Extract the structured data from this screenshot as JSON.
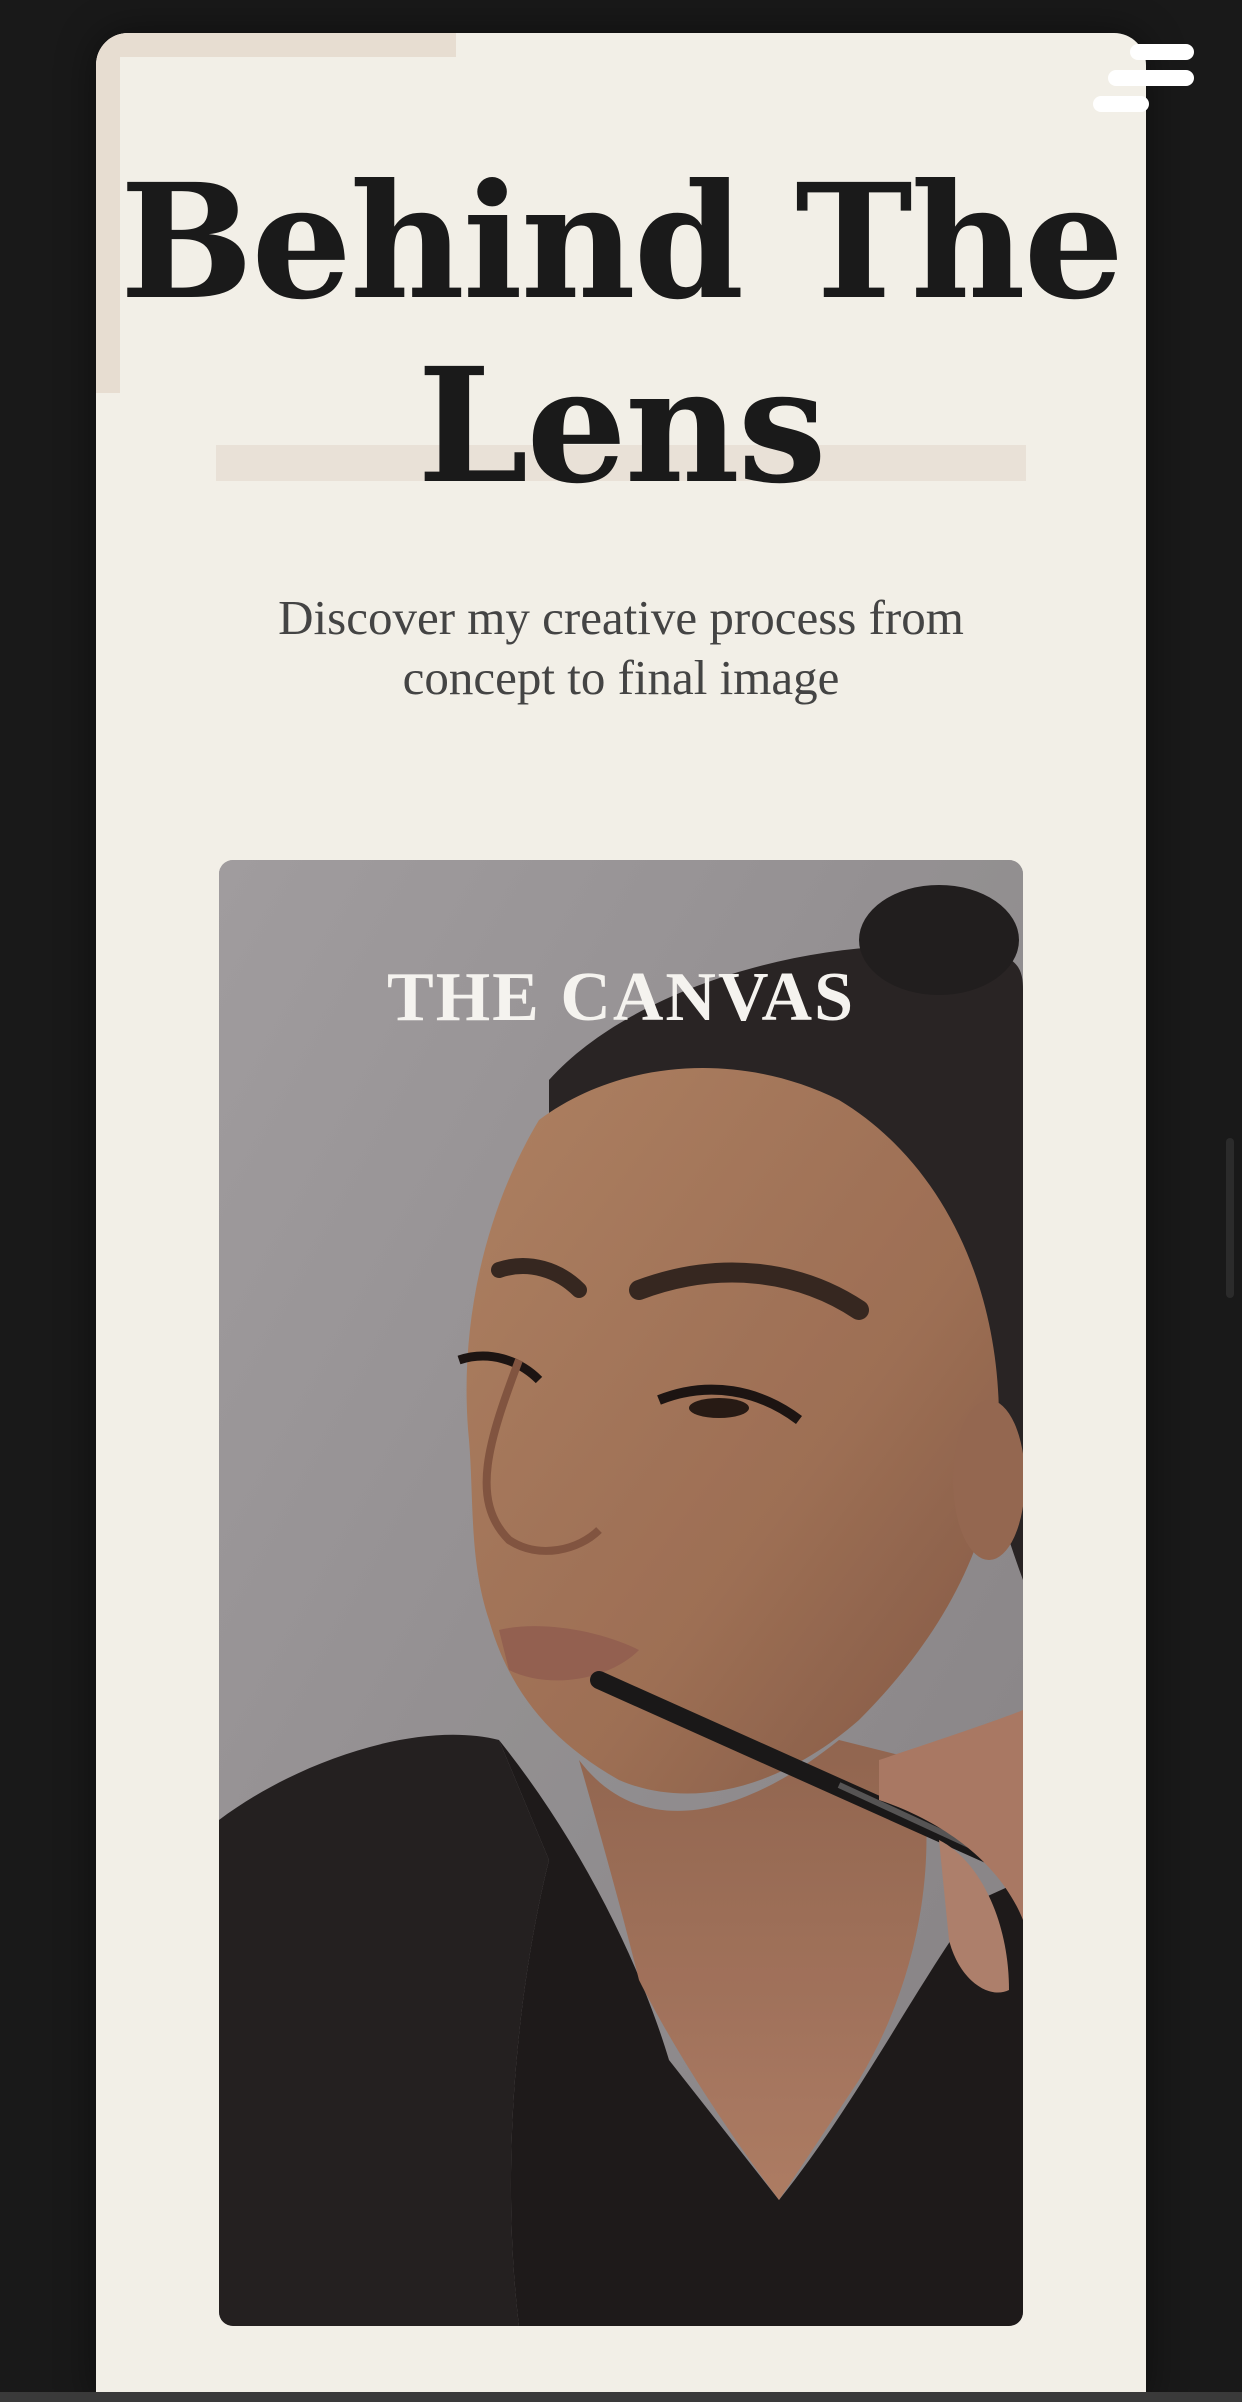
{
  "hero": {
    "title_line1": "Behind The",
    "title_line2": "Lens",
    "subtitle": "Discover my creative process from concept to final image"
  },
  "media_card": {
    "label": "THE CANVAS",
    "image_icon": "portrait-makeup-photo"
  },
  "menu": {
    "icon": "hamburger-menu-icon"
  },
  "colors": {
    "page_background": "#191919",
    "card_background": "#f2efe7",
    "accent": "#e7ddd1",
    "title_text": "#1a1a1a",
    "subtitle_text": "#444444",
    "label_text": "#f5f3ef"
  }
}
